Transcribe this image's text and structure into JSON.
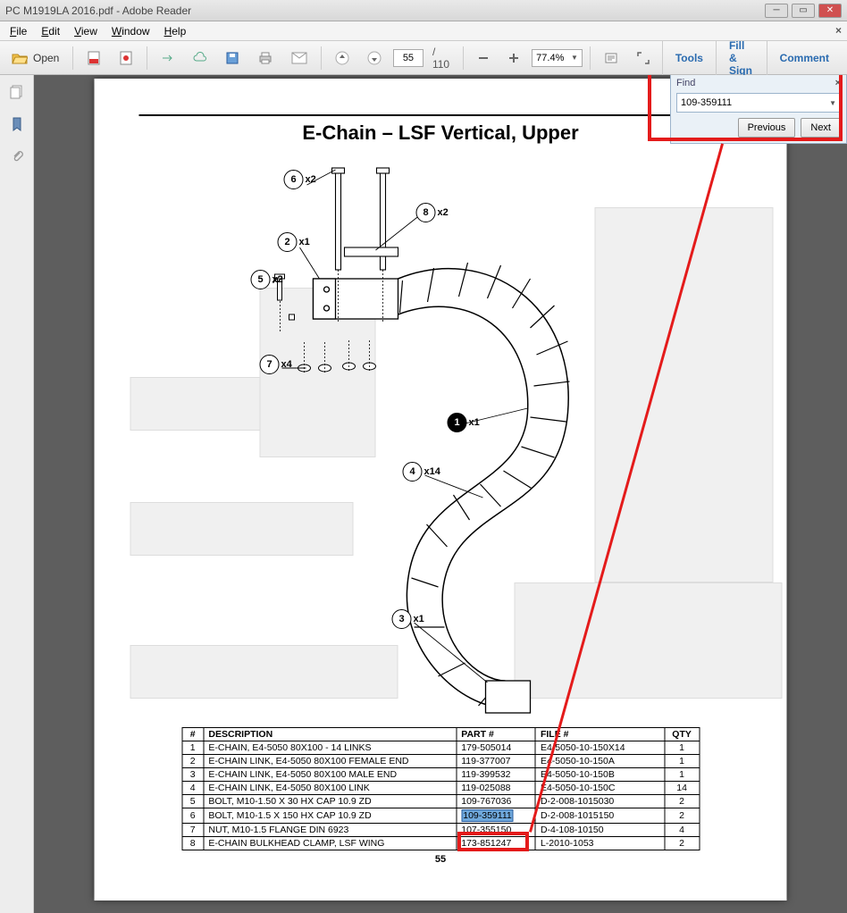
{
  "window": {
    "title": "PC M1919LA 2016.pdf - Adobe Reader"
  },
  "menu": {
    "file": "File",
    "edit": "Edit",
    "view": "View",
    "window": "Window",
    "help": "Help"
  },
  "toolbar": {
    "open": "Open",
    "page_current": "55",
    "page_sep": "/ 110",
    "zoom": "77.4%",
    "tools": "Tools",
    "fillsign": "Fill & Sign",
    "comment": "Comment"
  },
  "find": {
    "title": "Find",
    "value": "109-359111",
    "prev": "Previous",
    "next": "Next"
  },
  "doc": {
    "title": "E-Chain – LSF Vertical, Upper",
    "pagenum": "55",
    "callouts": {
      "c1": {
        "n": "1",
        "q": "x1"
      },
      "c2": {
        "n": "2",
        "q": "x1"
      },
      "c3": {
        "n": "3",
        "q": "x1"
      },
      "c4": {
        "n": "4",
        "q": "x14"
      },
      "c5": {
        "n": "5",
        "q": "x2"
      },
      "c6": {
        "n": "6",
        "q": "x2"
      },
      "c7": {
        "n": "7",
        "q": "x4"
      },
      "c8": {
        "n": "8",
        "q": "x2"
      }
    },
    "table": {
      "h1": "#",
      "h2": "DESCRIPTION",
      "h3": "PART #",
      "h4": "FILE #",
      "h5": "QTY",
      "rows": [
        {
          "n": "1",
          "d": "E-CHAIN, E4-5050 80X100 - 14 LINKS",
          "p": "179-505014",
          "f": "E4-5050-10-150X14",
          "q": "1"
        },
        {
          "n": "2",
          "d": "E-CHAIN LINK, E4-5050 80X100 FEMALE END",
          "p": "119-377007",
          "f": "E4-5050-10-150A",
          "q": "1"
        },
        {
          "n": "3",
          "d": "E-CHAIN LINK, E4-5050 80X100 MALE END",
          "p": "119-399532",
          "f": "E4-5050-10-150B",
          "q": "1"
        },
        {
          "n": "4",
          "d": "E-CHAIN LINK, E4-5050 80X100 LINK",
          "p": "119-025088",
          "f": "E4-5050-10-150C",
          "q": "14"
        },
        {
          "n": "5",
          "d": "BOLT, M10-1.50 X 30 HX CAP 10.9 ZD",
          "p": "109-767036",
          "f": "D-2-008-1015030",
          "q": "2"
        },
        {
          "n": "6",
          "d": "BOLT, M10-1.5 X 150 HX CAP 10.9 ZD",
          "p": "109-359111",
          "f": "D-2-008-1015150",
          "q": "2"
        },
        {
          "n": "7",
          "d": "NUT, M10-1.5 FLANGE DIN 6923",
          "p": "107-355150",
          "f": "D-4-108-10150",
          "q": "4"
        },
        {
          "n": "8",
          "d": "E-CHAIN BULKHEAD CLAMP, LSF WING",
          "p": "173-851247",
          "f": "L-2010-1053",
          "q": "2"
        }
      ]
    }
  }
}
